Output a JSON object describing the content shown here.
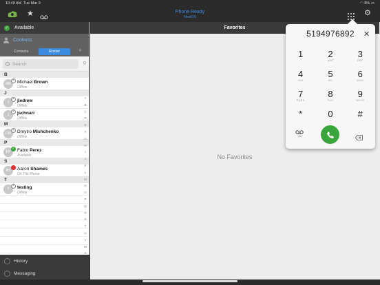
{
  "status_bar": {
    "time": "10:49 AM",
    "date": "Tue Mar 9",
    "battery": "8%"
  },
  "header": {
    "title": "Phone Ready",
    "subtitle": "NextOS"
  },
  "presence": {
    "label": "Available"
  },
  "sidebar": {
    "section_label": "Contacts",
    "segments": [
      "Contacts",
      "Roster"
    ],
    "search_placeholder": "Search",
    "search_index_letter": "Q",
    "groups": [
      {
        "letter": "B",
        "contacts": [
          {
            "initials": "MB",
            "first": "Michael ",
            "last": "Brown",
            "status": "Offline",
            "state": "offline"
          }
        ]
      },
      {
        "letter": "J",
        "contacts": [
          {
            "initials": "J",
            "first": "",
            "last": "jledrew",
            "status": "Offline",
            "state": "offline"
          },
          {
            "initials": "J",
            "first": "",
            "last": "jschnarr",
            "status": "Offline",
            "state": "offline"
          }
        ]
      },
      {
        "letter": "M",
        "contacts": [
          {
            "initials": "DM",
            "first": "Dmytro ",
            "last": "Mishchenko",
            "status": "Offline",
            "state": "offline"
          }
        ]
      },
      {
        "letter": "P",
        "contacts": [
          {
            "initials": "FP",
            "first": "Fabio ",
            "last": "Perez",
            "status": "Available",
            "state": "available"
          }
        ]
      },
      {
        "letter": "S",
        "contacts": [
          {
            "initials": "AS",
            "first": "Aaron ",
            "last": "Shames",
            "status": "On The Phone",
            "state": "busy"
          }
        ]
      },
      {
        "letter": "T",
        "contacts": [
          {
            "initials": "T",
            "first": "",
            "last": "testing",
            "status": "Offline",
            "state": "offline"
          }
        ]
      }
    ],
    "index_letters": [
      "A",
      "B",
      "C",
      "D",
      "E",
      "F",
      "G",
      "H",
      "I",
      "J",
      "K",
      "L",
      "M",
      "N",
      "O",
      "P",
      "Q",
      "R",
      "S",
      "T",
      "U",
      "V",
      "W",
      "X",
      "Y",
      "Z",
      "#"
    ],
    "bottom_nav": [
      "History",
      "Messaging"
    ]
  },
  "main": {
    "title": "Favorites",
    "empty_text": "No Favorites"
  },
  "dialer": {
    "number": "5194976892",
    "keys": [
      {
        "digit": "1",
        "letters": ""
      },
      {
        "digit": "2",
        "letters": "ABC"
      },
      {
        "digit": "3",
        "letters": "DEF"
      },
      {
        "digit": "4",
        "letters": "GHI"
      },
      {
        "digit": "5",
        "letters": "JKL"
      },
      {
        "digit": "6",
        "letters": "MNO"
      },
      {
        "digit": "7",
        "letters": "PQRS"
      },
      {
        "digit": "8",
        "letters": "TUV"
      },
      {
        "digit": "9",
        "letters": "WXYZ"
      },
      {
        "digit": "*",
        "letters": ""
      },
      {
        "digit": "0",
        "letters": "+"
      },
      {
        "digit": "#",
        "letters": ""
      }
    ],
    "voicemail_label": "VM"
  },
  "colors": {
    "accent": "#3b8be0",
    "available": "#3aa53a",
    "busy": "#dd3333",
    "dark": "#2b2b2b"
  }
}
